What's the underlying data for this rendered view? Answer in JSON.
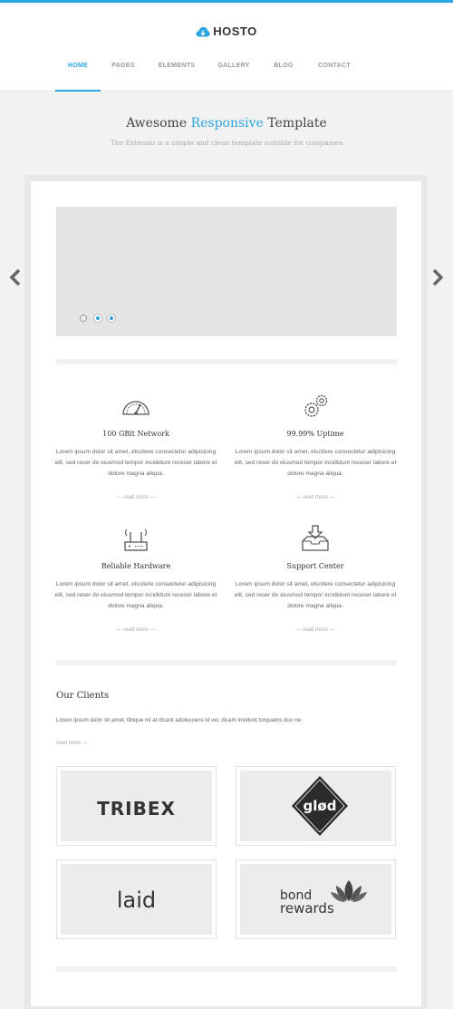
{
  "brand": {
    "name": "HOSTO",
    "accent_color": "#2ba6e1"
  },
  "nav": {
    "items": [
      "HOME",
      "PAGES",
      "ELEMENTS",
      "GALLERY",
      "BLOG",
      "CONTACT"
    ],
    "active": "HOME"
  },
  "hero": {
    "title_start": "Awesome ",
    "title_accent": "Responsive",
    "title_end": " Template",
    "subtitle": "The Extensio is a simple and clean template suitable for companies"
  },
  "slider": {
    "slides": 3,
    "active_slide": 1
  },
  "features": [
    {
      "icon": "speedometer-icon",
      "title": "100 GBit Network",
      "text": "Lorem ipsum dolor sit amet, elscitere consectetur adipisicing elit, sed reser do eiusmod tempor incididunt receser labore et dolore magna aliqua.",
      "more": "— read more —"
    },
    {
      "icon": "gears-icon",
      "title": "99.99% Uptime",
      "text": "Lorem ipsum dolor sit amet, elscitere consectetur adipisicing elit, sed reser do eiusmod tempor incididunt receser labore et dolore magna aliqua.",
      "more": "— read more —"
    },
    {
      "icon": "router-icon",
      "title": "Reliable Hardware",
      "text": "Lorem ipsum dolor sit amet, elscitere consectetur adipisicing elit, sed reser do eiusmod tempor incididunt receser labore et dolore magna aliqua.",
      "more": "— read more —"
    },
    {
      "icon": "inbox-download-icon",
      "title": "Support Center",
      "text": "Lorem ipsum dolor sit amet, elscitere consectetur adipisicing elit, sed reser do eiusmod tempor incididunt receser labore et dolore magna aliqua.",
      "more": "— read more —"
    }
  ],
  "clients": {
    "title": "Our Clients",
    "text": "Lorem ipsum dolor sit amet, tibique mi at dicant adolescens id vel, dicam invidunt torquatos duo ne.",
    "more": "read more —",
    "logos": [
      {
        "name": "TRIBEX"
      },
      {
        "name": "glød"
      },
      {
        "name": "laid"
      },
      {
        "name_line1": "bond",
        "name_line2": "rewards"
      }
    ]
  }
}
